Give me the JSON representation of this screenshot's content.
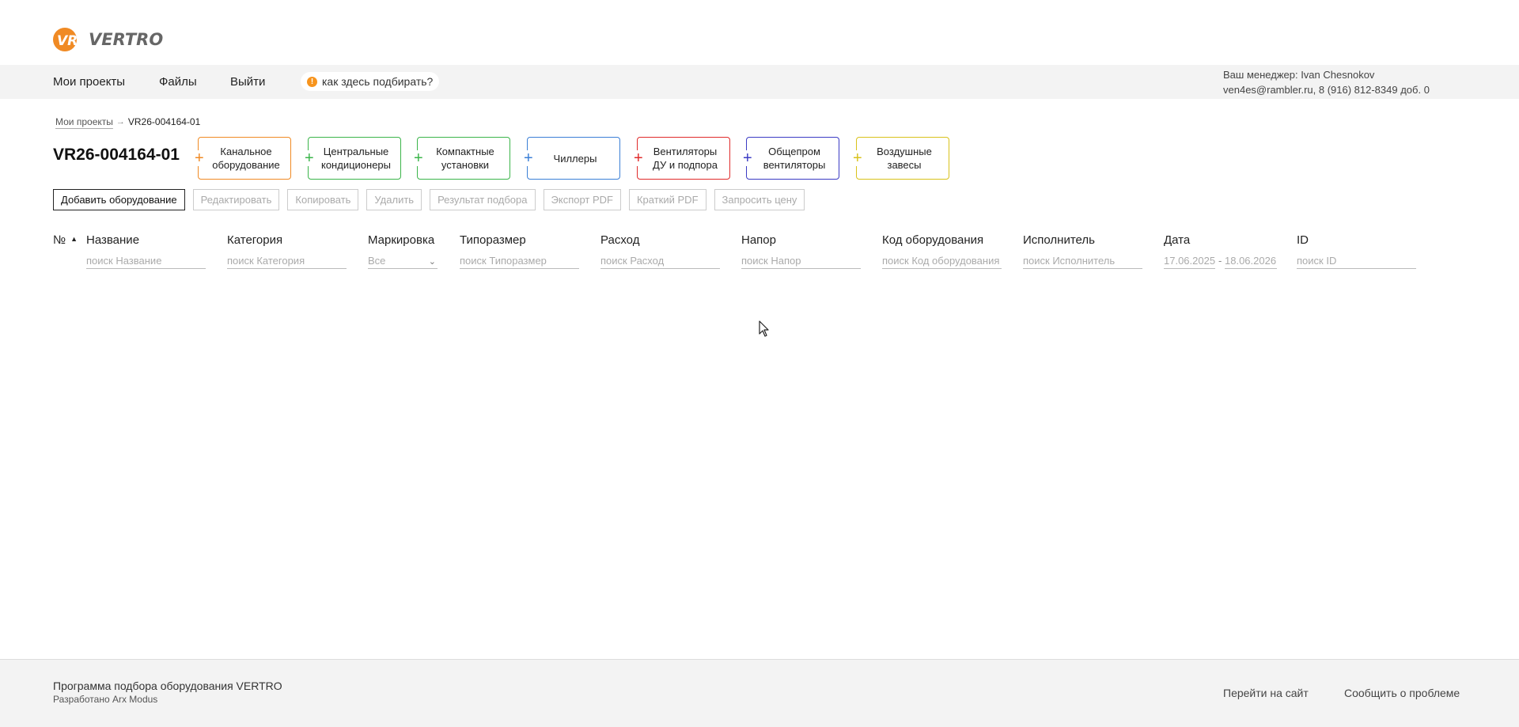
{
  "brand": {
    "logo_text": "VERTRO",
    "accent": "#f08a24"
  },
  "nav": {
    "items": [
      "Мои проекты",
      "Файлы",
      "Выйти"
    ],
    "help": "как здесь подбирать?",
    "manager_line1": "Ваш менеджер: Ivan Chesnokov",
    "manager_line2": "ven4es@rambler.ru, 8 (916) 812-8349 доб. 0"
  },
  "breadcrumb": {
    "link": "Мои проекты",
    "current": "VR26-004164-01"
  },
  "project": {
    "title": "VR26-004164-01"
  },
  "categories": [
    {
      "label": "Канальное оборудование",
      "color": "#f08a24"
    },
    {
      "label": "Центральные кондиционеры",
      "color": "#3bb54a"
    },
    {
      "label": "Компактные установки",
      "color": "#3bb54a"
    },
    {
      "label": "Чиллеры",
      "color": "#3b7fd6"
    },
    {
      "label": "Вентиляторы ДУ и подпора",
      "color": "#e02b2b"
    },
    {
      "label": "Общепром вентиляторы",
      "color": "#3b3bc4"
    },
    {
      "label": "Воздушные завесы",
      "color": "#d9c21b"
    }
  ],
  "toolbar": {
    "add": "Добавить оборудование",
    "edit": "Редактировать",
    "copy": "Копировать",
    "delete": "Удалить",
    "result": "Результат подбора",
    "export_pdf": "Экспорт PDF",
    "short_pdf": "Краткий PDF",
    "request_price": "Запросить цену"
  },
  "table": {
    "columns": {
      "num": "№",
      "name": "Название",
      "category": "Категория",
      "marking": "Маркировка",
      "size": "Типоразмер",
      "flow": "Расход",
      "pressure": "Напор",
      "code": "Код оборудования",
      "executor": "Исполнитель",
      "date": "Дата",
      "id": "ID"
    },
    "filters": {
      "name": "поиск Название",
      "category": "поиск Категория",
      "marking": "Все",
      "size": "поиск Типоразмер",
      "flow": "поиск Расход",
      "pressure": "поиск Напор",
      "code": "поиск Код оборудования",
      "executor": "поиск Исполнитель",
      "date_from": "17.06.2025",
      "date_to": "18.06.2026",
      "id": "поиск ID"
    }
  },
  "footer": {
    "program": "Программа подбора оборудования VERTRO",
    "developer": "Разработано Arx Modus",
    "go_site": "Перейти на сайт",
    "report": "Сообщить о проблеме"
  }
}
